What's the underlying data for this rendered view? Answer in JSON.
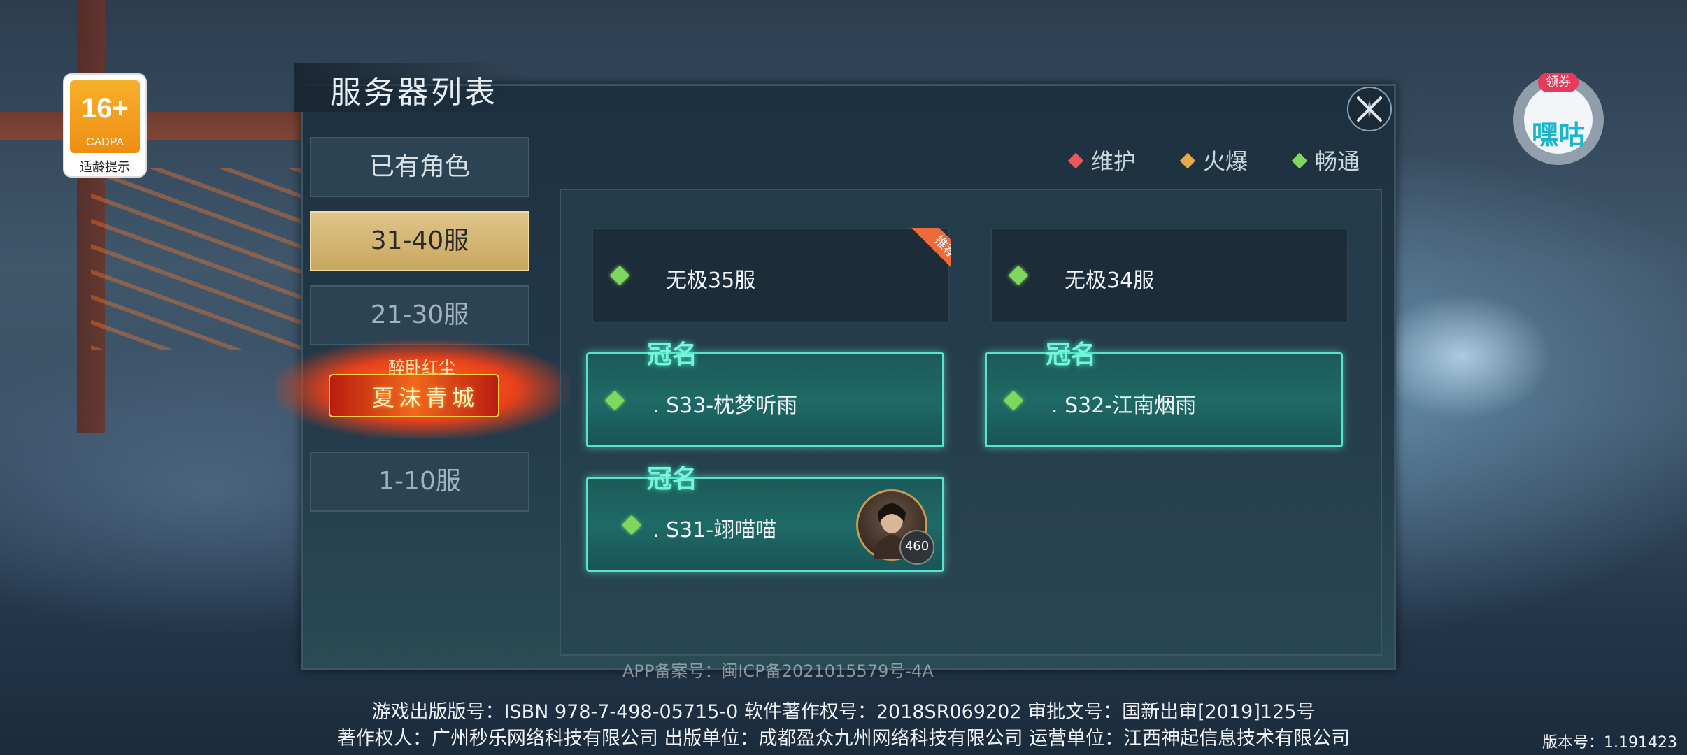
{
  "age_rating": {
    "rating": "16+",
    "org": "CADPA",
    "tip": "适龄提示"
  },
  "coupon": {
    "tag": "领券",
    "label": "嘿咕"
  },
  "panel": {
    "title": "服务器列表"
  },
  "tabs": [
    {
      "label": "已有角色",
      "state": "owned"
    },
    {
      "label": "31-40服",
      "state": "active"
    },
    {
      "label": "21-30服",
      "state": "normal"
    },
    {
      "label": "1-10服",
      "state": "normal"
    }
  ],
  "title_emblem": {
    "top": "醉卧红尘",
    "main": "夏沫青城"
  },
  "legend": [
    {
      "label": "维护",
      "color": "#e85a5a"
    },
    {
      "label": "火爆",
      "color": "#e8a94a"
    },
    {
      "label": "畅通",
      "color": "#7fd75c"
    }
  ],
  "servers": [
    {
      "name": "无极35服",
      "status_color": "#7fd75c",
      "tag": "推荐"
    },
    {
      "name": "无极34服",
      "status_color": "#7fd75c"
    },
    {
      "name": ". S33-枕梦听雨",
      "status_color": "#7fd75c",
      "crown": "冠名"
    },
    {
      "name": ". S32-江南烟雨",
      "status_color": "#7fd75c",
      "crown": "冠名"
    },
    {
      "name": ". S31-翊喵喵",
      "status_color": "#7fd75c",
      "crown": "冠名",
      "character_level": "460"
    }
  ],
  "footer": {
    "icp": "APP备案号：闽ICP备2021015579号-4A",
    "line1": "游戏出版版号：ISBN 978-7-498-05715-0 软件著作权号：2018SR069202 审批文号：国新出审[2019]125号",
    "line2": "著作权人：广州秒乐网络科技有限公司 出版单位：成都盈众九州网络科技有限公司 运营单位：江西神起信息技术有限公司",
    "version": "版本号：1.191423"
  }
}
